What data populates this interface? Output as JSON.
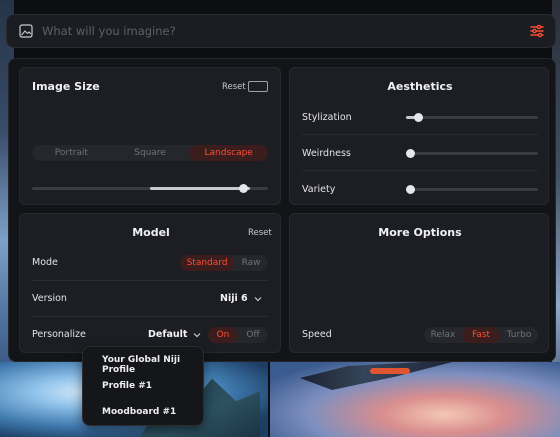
{
  "search": {
    "placeholder": "What will you imagine?"
  },
  "image_size": {
    "title": "Image Size",
    "reset_label": "Reset",
    "options": [
      "Portrait",
      "Square",
      "Landscape"
    ],
    "selected": "Landscape",
    "slider_level": 0.92
  },
  "aesthetics": {
    "title": "Aesthetics",
    "rows": [
      {
        "label": "Stylization",
        "level": 0.1
      },
      {
        "label": "Weirdness",
        "level": 0.0
      },
      {
        "label": "Variety",
        "level": 0.0
      }
    ]
  },
  "model": {
    "title": "Model",
    "reset_label": "Reset",
    "mode_label": "Mode",
    "mode_options": [
      "Standard",
      "Raw"
    ],
    "mode_selected": "Standard",
    "version_label": "Version",
    "version_value": "Niji 6",
    "personalize_label": "Personalize",
    "personalize_value": "Default",
    "personalize_toggle": [
      "On",
      "Off"
    ],
    "personalize_selected": "On"
  },
  "more_options": {
    "title": "More Options",
    "speed_label": "Speed",
    "speed_options": [
      "Relax",
      "Fast",
      "Turbo"
    ],
    "speed_selected": "Fast"
  },
  "personalize_menu": {
    "items": [
      "Your Global Niji Profile",
      "Profile #1",
      "Moodboard #1"
    ]
  },
  "colors": {
    "accent": "#ff4d33",
    "accent_bg": "#3a1d1c",
    "card_bg": "#1c1e23",
    "panel_bg": "#131418"
  },
  "icons": {
    "search_left": "image-icon",
    "search_right": "sliders-icon",
    "chevron": "chevron-down-icon"
  }
}
